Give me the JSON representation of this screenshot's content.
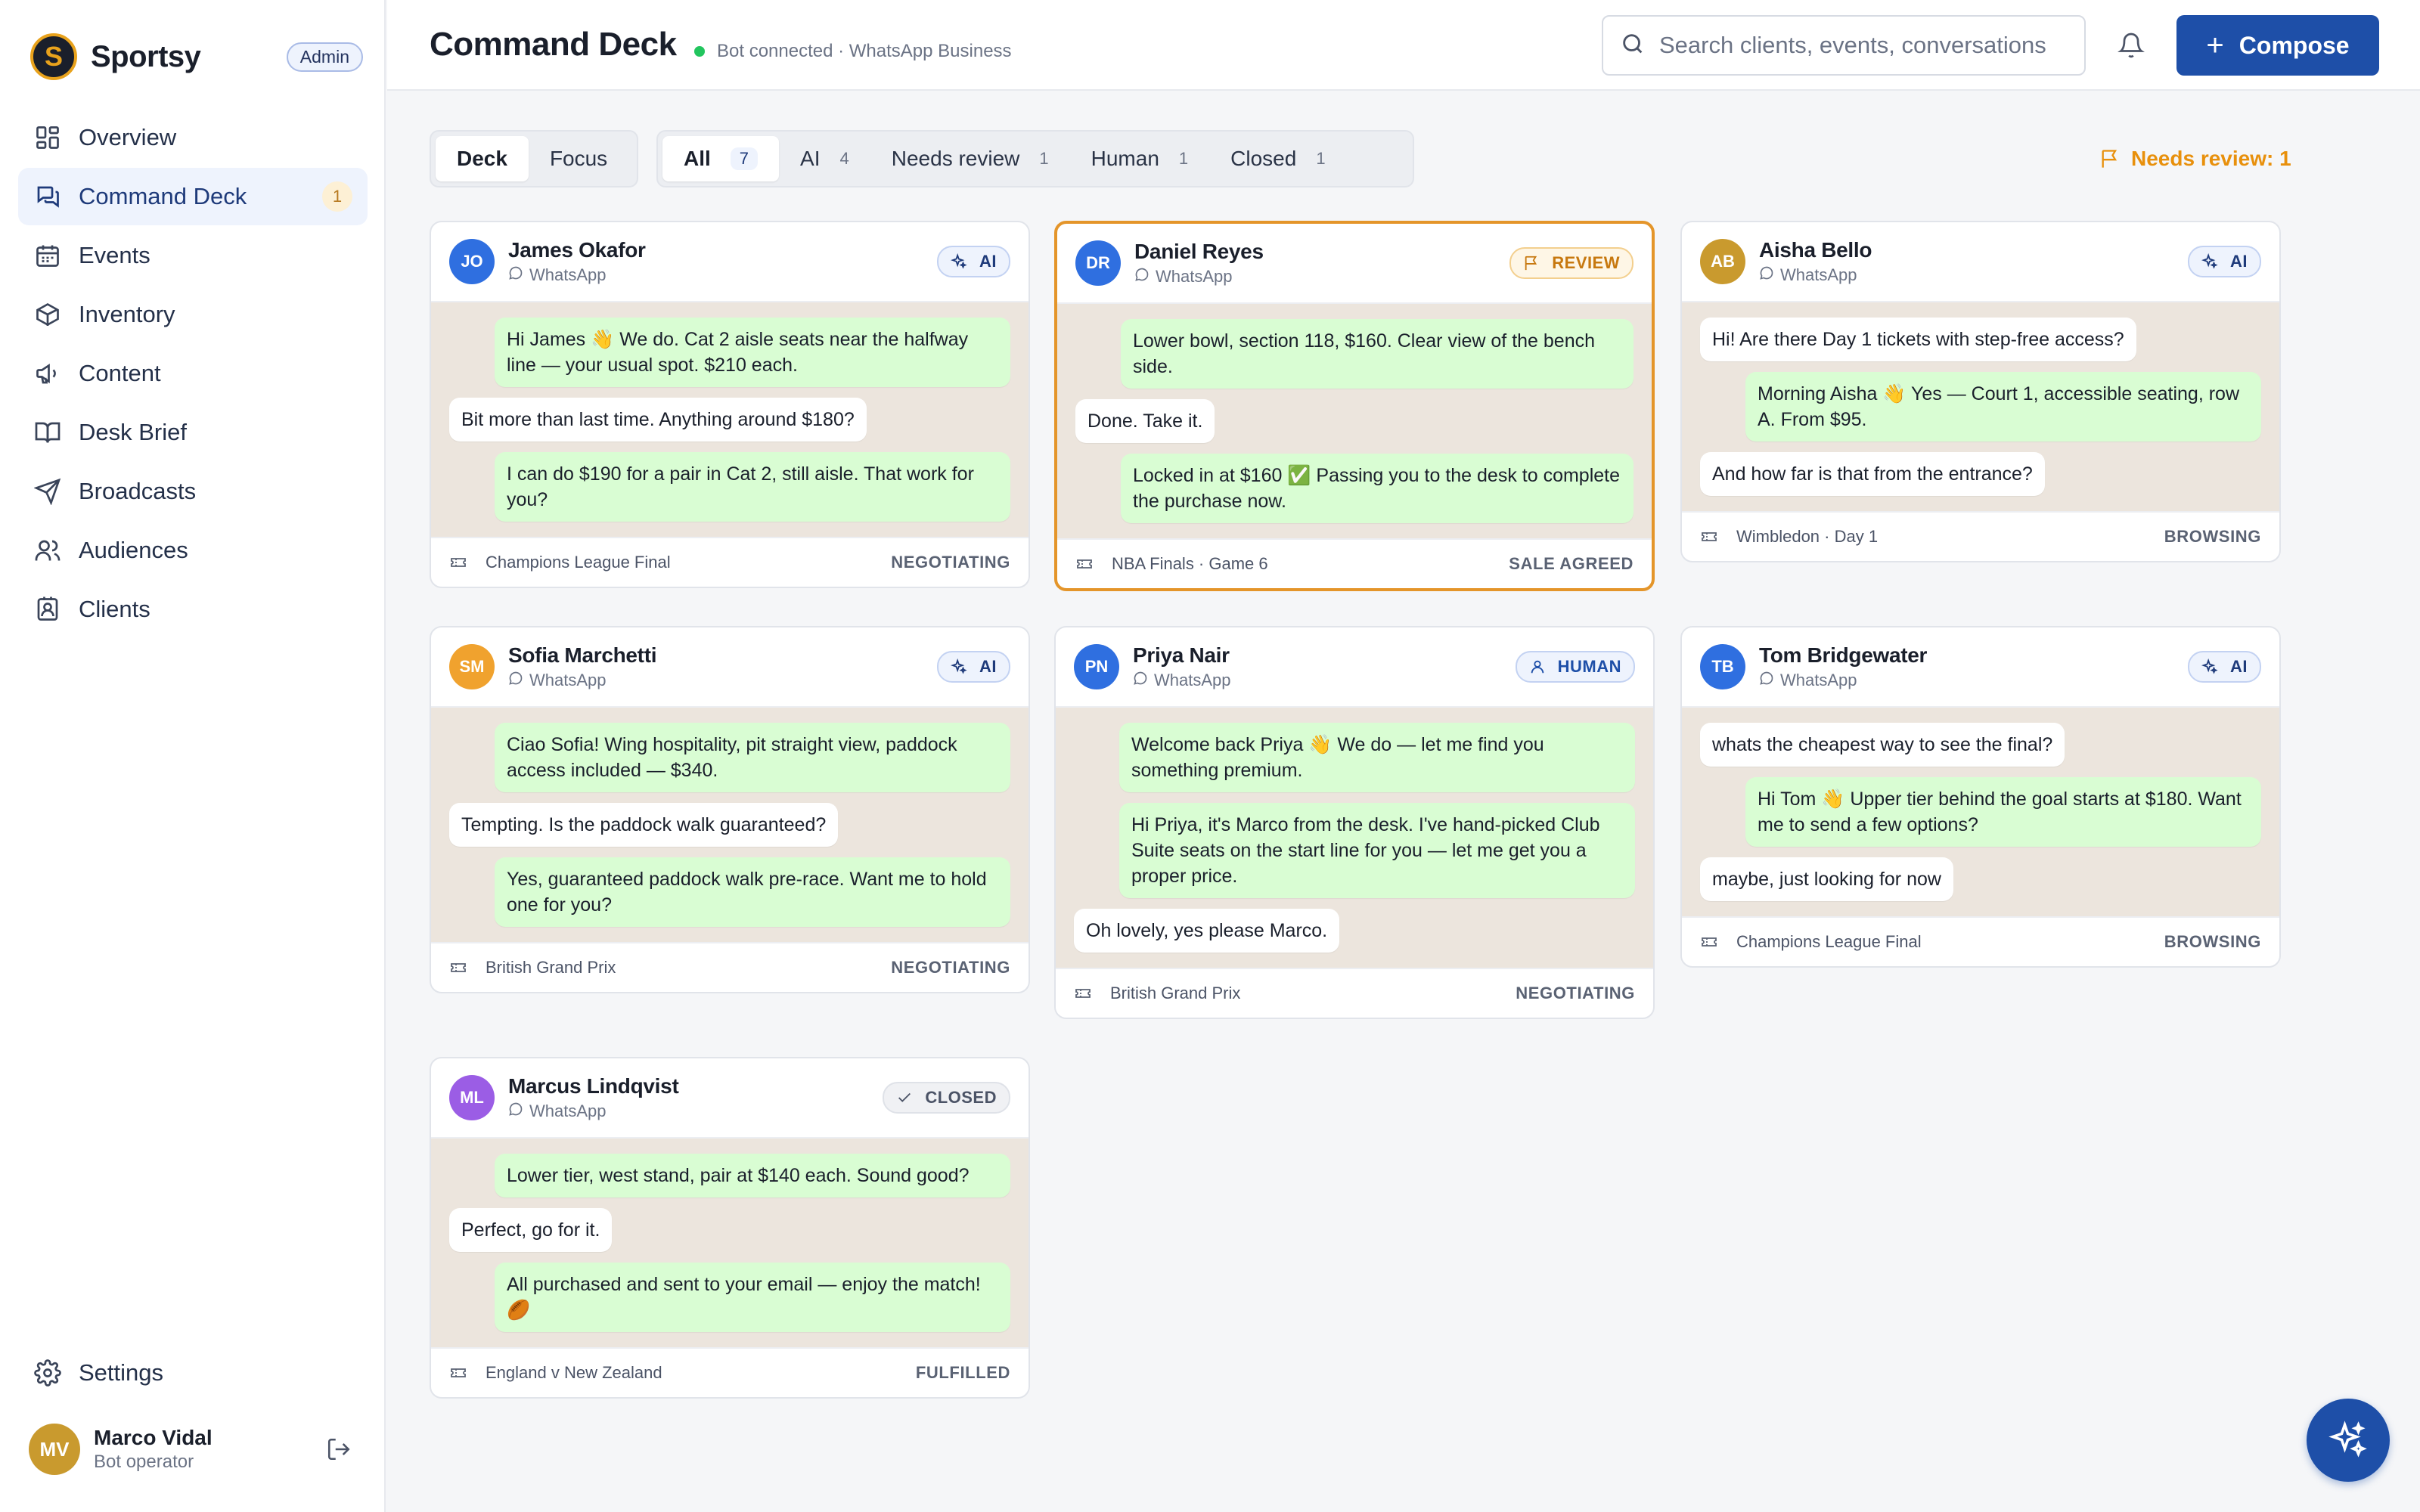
{
  "app": {
    "name": "Sportsy",
    "logo_letter": "S",
    "role_badge": "Admin"
  },
  "nav": [
    {
      "label": "Overview",
      "icon": "grid-icon"
    },
    {
      "label": "Command Deck",
      "icon": "chat-icon",
      "active": true,
      "count": "1"
    },
    {
      "label": "Events",
      "icon": "calendar-icon"
    },
    {
      "label": "Inventory",
      "icon": "box-icon"
    },
    {
      "label": "Content",
      "icon": "megaphone-icon"
    },
    {
      "label": "Desk Brief",
      "icon": "book-icon"
    },
    {
      "label": "Broadcasts",
      "icon": "send-icon"
    },
    {
      "label": "Audiences",
      "icon": "users-icon"
    },
    {
      "label": "Clients",
      "icon": "contact-icon"
    }
  ],
  "settings_label": "Settings",
  "user": {
    "initials": "MV",
    "name": "Marco Vidal",
    "role": "Bot operator"
  },
  "header": {
    "title": "Command Deck",
    "status": "Bot connected · WhatsApp Business",
    "search_placeholder": "Search clients, events, conversations",
    "compose_label": "Compose"
  },
  "view_toggle": [
    "Deck",
    "Focus"
  ],
  "filters": [
    {
      "label": "All",
      "count": "7"
    },
    {
      "label": "AI",
      "count": "4"
    },
    {
      "label": "Needs review",
      "count": "1"
    },
    {
      "label": "Human",
      "count": "1"
    },
    {
      "label": "Closed",
      "count": "1"
    }
  ],
  "review_notice": "Needs review: 1",
  "colors": {
    "accent": "#1e4fa8",
    "review": "#e4952a",
    "online": "#22c55e"
  },
  "cards": [
    {
      "initials": "JO",
      "avatar_color": "#2f6fe0",
      "name": "James Okafor",
      "channel": "WhatsApp",
      "tag": "AI",
      "tag_type": "ai",
      "messages": [
        {
          "dir": "out",
          "text": "Hi James 👋 We do. Cat 2 aisle seats near the halfway line — your usual spot. $210 each."
        },
        {
          "dir": "in",
          "text": "Bit more than last time. Anything around $180?"
        },
        {
          "dir": "out",
          "text": "I can do $190 for a pair in Cat 2, still aisle. That work for you?"
        }
      ],
      "event": "Champions League Final",
      "stage": "NEGOTIATING"
    },
    {
      "initials": "DR",
      "avatar_color": "#2f6fe0",
      "name": "Daniel Reyes",
      "channel": "WhatsApp",
      "tag": "REVIEW",
      "tag_type": "rev",
      "messages": [
        {
          "dir": "out",
          "text": "Lower bowl, section 118, $160. Clear view of the bench side."
        },
        {
          "dir": "in",
          "text": "Done. Take it."
        },
        {
          "dir": "out",
          "text": "Locked in at $160 ✅ Passing you to the desk to complete the purchase now."
        }
      ],
      "event": "NBA Finals · Game 6",
      "stage": "SALE AGREED"
    },
    {
      "initials": "AB",
      "avatar_color": "#c99a2e",
      "name": "Aisha Bello",
      "channel": "WhatsApp",
      "tag": "AI",
      "tag_type": "ai",
      "messages": [
        {
          "dir": "in",
          "text": "Hi! Are there Day 1 tickets with step-free access?"
        },
        {
          "dir": "out",
          "text": "Morning Aisha 👋 Yes — Court 1, accessible seating, row A. From $95."
        },
        {
          "dir": "in",
          "text": "And how far is that from the entrance?"
        }
      ],
      "event": "Wimbledon · Day 1",
      "stage": "BROWSING"
    },
    {
      "initials": "SM",
      "avatar_color": "#f0a22e",
      "name": "Sofia Marchetti",
      "channel": "WhatsApp",
      "tag": "AI",
      "tag_type": "ai",
      "messages": [
        {
          "dir": "out",
          "text": "Ciao Sofia! Wing hospitality, pit straight view, paddock access included — $340."
        },
        {
          "dir": "in",
          "text": "Tempting. Is the paddock walk guaranteed?"
        },
        {
          "dir": "out",
          "text": "Yes, guaranteed paddock walk pre-race. Want me to hold one for you?"
        }
      ],
      "event": "British Grand Prix",
      "stage": "NEGOTIATING"
    },
    {
      "initials": "PN",
      "avatar_color": "#2f6fe0",
      "name": "Priya Nair",
      "channel": "WhatsApp",
      "tag": "HUMAN",
      "tag_type": "hum",
      "messages": [
        {
          "dir": "out",
          "text": "Welcome back Priya 👋 We do — let me find you something premium."
        },
        {
          "dir": "out",
          "text": "Hi Priya, it's Marco from the desk. I've hand-picked Club Suite seats on the start line for you — let me get you a proper price."
        },
        {
          "dir": "in",
          "text": "Oh lovely, yes please Marco."
        }
      ],
      "event": "British Grand Prix",
      "stage": "NEGOTIATING"
    },
    {
      "initials": "TB",
      "avatar_color": "#2f6fe0",
      "name": "Tom Bridgewater",
      "channel": "WhatsApp",
      "tag": "AI",
      "tag_type": "ai",
      "messages": [
        {
          "dir": "in",
          "text": "whats the cheapest way to see the final?"
        },
        {
          "dir": "out",
          "text": "Hi Tom 👋 Upper tier behind the goal starts at $180. Want me to send a few options?"
        },
        {
          "dir": "in",
          "text": "maybe, just looking for now"
        }
      ],
      "event": "Champions League Final",
      "stage": "BROWSING"
    },
    {
      "initials": "ML",
      "avatar_color": "#9b5de5",
      "name": "Marcus Lindqvist",
      "channel": "WhatsApp",
      "tag": "CLOSED",
      "tag_type": "closed",
      "messages": [
        {
          "dir": "out",
          "text": "Lower tier, west stand, pair at $140 each. Sound good?"
        },
        {
          "dir": "in",
          "text": "Perfect, go for it."
        },
        {
          "dir": "out",
          "text": "All purchased and sent to your email — enjoy the match! 🏉"
        }
      ],
      "event": "England v New Zealand",
      "stage": "FULFILLED"
    }
  ]
}
